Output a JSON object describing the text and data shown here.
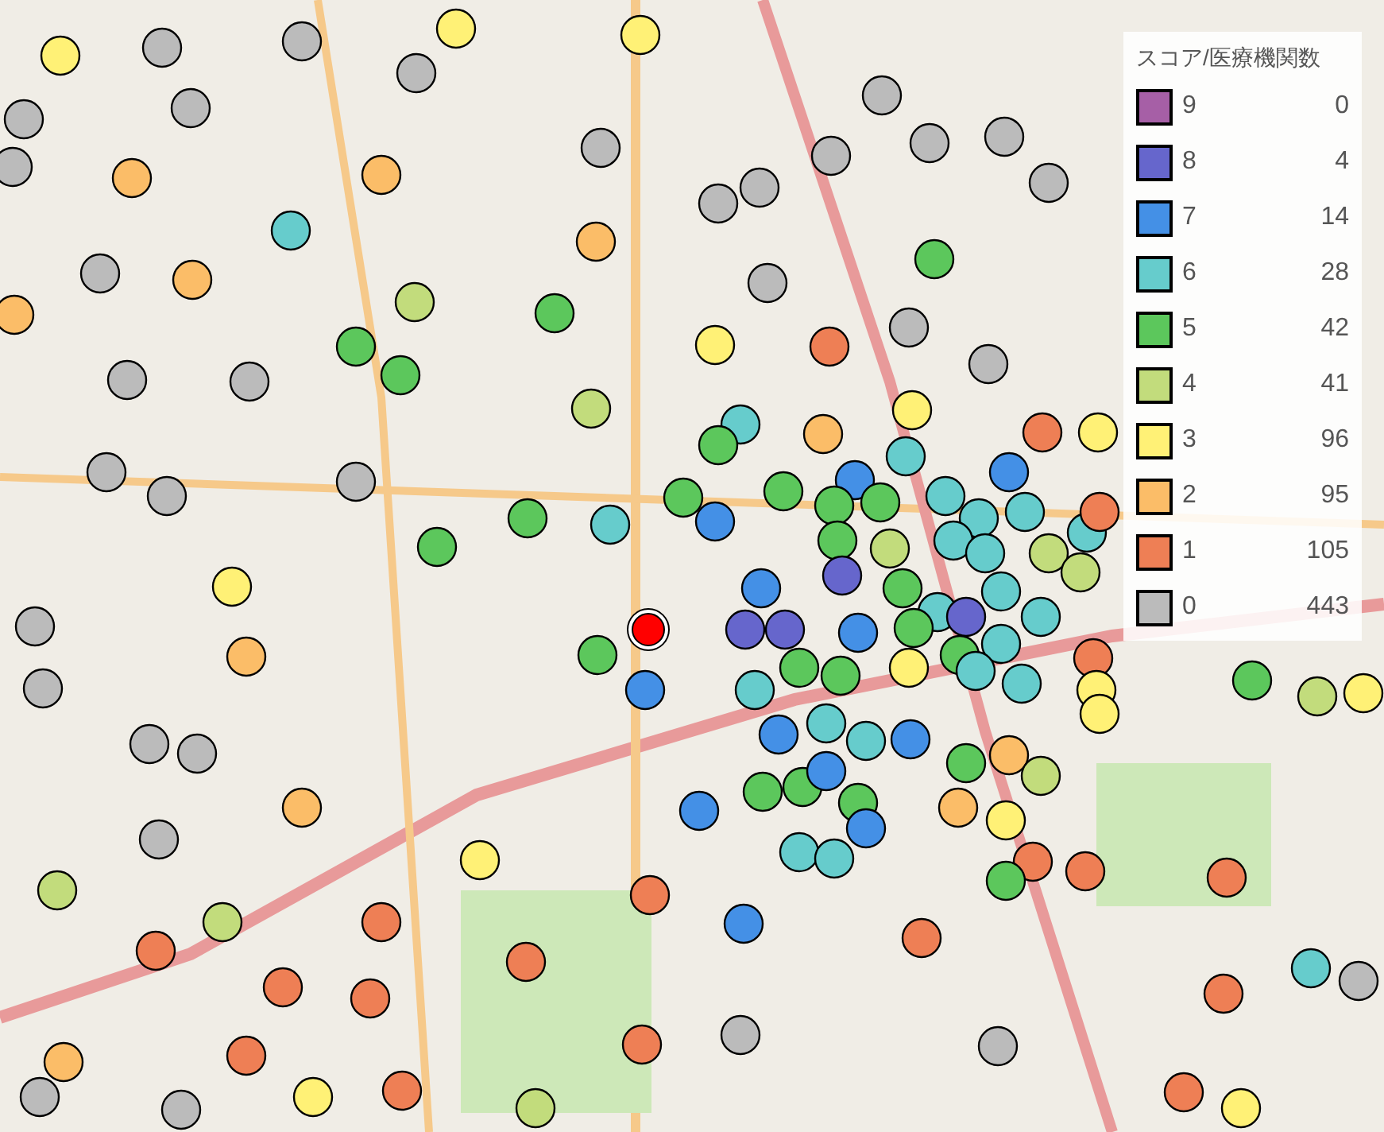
{
  "legend": {
    "title": "スコア/医療機関数",
    "items": [
      {
        "score": "9",
        "count": "0",
        "color": "#a65fa6"
      },
      {
        "score": "8",
        "count": "4",
        "color": "#6666cc"
      },
      {
        "score": "7",
        "count": "14",
        "color": "#4490e6"
      },
      {
        "score": "6",
        "count": "28",
        "color": "#66cccc"
      },
      {
        "score": "5",
        "count": "42",
        "color": "#5cc75c"
      },
      {
        "score": "4",
        "count": "41",
        "color": "#c2dc7c"
      },
      {
        "score": "3",
        "count": "96",
        "color": "#fff176"
      },
      {
        "score": "2",
        "count": "95",
        "color": "#fbbd68"
      },
      {
        "score": "1",
        "count": "105",
        "color": "#ee7f55"
      },
      {
        "score": "0",
        "count": "443",
        "color": "#bbbbbb"
      }
    ]
  }
}
